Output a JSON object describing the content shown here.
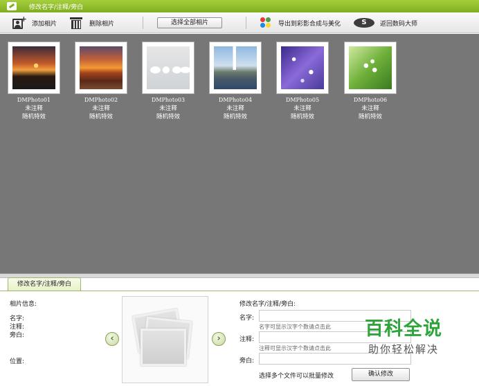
{
  "window": {
    "title": "修改名字/注释/旁白"
  },
  "toolbar": {
    "add_label": "添加相片",
    "delete_label": "删除相片",
    "select_all_label": "选择全部相片",
    "export_label": "导出到彩影合成与美化",
    "back_label": "返回数码大师",
    "back_icon_text": "S"
  },
  "photos": [
    {
      "filename": "DMPhoto01",
      "note": "未注释",
      "effect": "随机特效"
    },
    {
      "filename": "DMPhoto02",
      "note": "未注释",
      "effect": "随机特效"
    },
    {
      "filename": "DMPhoto03",
      "note": "未注释",
      "effect": "随机特效"
    },
    {
      "filename": "DMPhoto04",
      "note": "未注释",
      "effect": "随机特效"
    },
    {
      "filename": "DMPhoto05",
      "note": "未注释",
      "effect": "随机特效"
    },
    {
      "filename": "DMPhoto06",
      "note": "未注释",
      "effect": "随机特效"
    }
  ],
  "panel": {
    "tab_label": "修改名字/注释/旁白",
    "info_heading": "相片信息:",
    "name_label": "名字:",
    "note_label": "注释:",
    "narration_label": "旁白:",
    "location_label": "位置:",
    "edit_heading": "修改名字/注释/旁白:",
    "edit_name_label": "名字:",
    "edit_note_label": "注释:",
    "edit_narration_label": "旁白:",
    "name_hint": "名字可显示汉字个数请点击此",
    "note_hint": "注释可显示汉字个数请点击此",
    "batch_hint": "选择多个文件可以批量修改",
    "confirm_label": "确认修改",
    "prev_glyph": "‹",
    "next_glyph": "›"
  },
  "watermark": {
    "title": "百科全说",
    "subtitle": "助你轻松解决"
  },
  "colors": {
    "title_bar": "#8dbb2a",
    "gallery_bg": "#777777",
    "watermark_green": "#2ea43b"
  }
}
